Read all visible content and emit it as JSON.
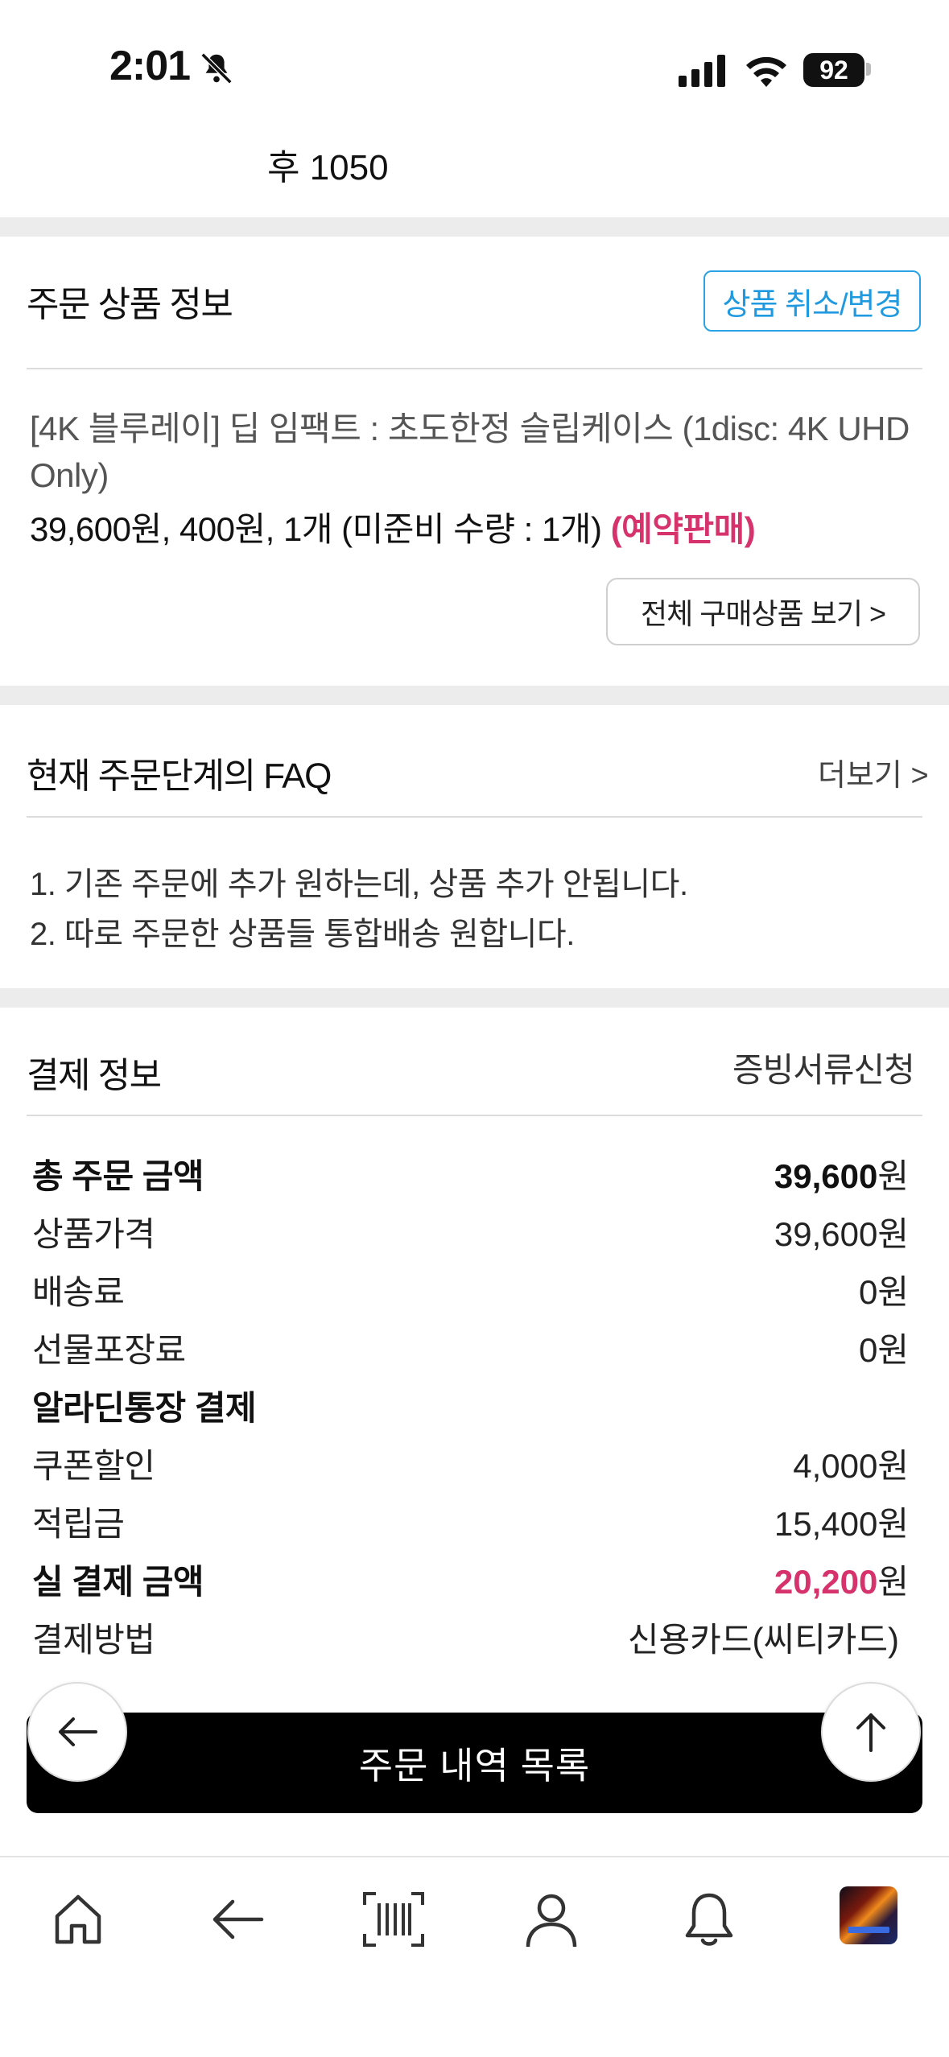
{
  "status": {
    "time": "2:01",
    "battery": "92"
  },
  "top_text": "후 1050",
  "order_product": {
    "title": "주문 상품 정보",
    "cancel_button": "상품 취소/변경",
    "product_name": "[4K 블루레이] 딥 임팩트 : 초도한정 슬립케이스 (1disc: 4K UHD Only)",
    "price_line": "39,600원, 400원, 1개 (미준비 수량 : 1개)",
    "presale_badge": "(예약판매)",
    "view_all_button": "전체 구매상품 보기 >"
  },
  "faq": {
    "title": "현재 주문단계의 FAQ",
    "more_label": "더보기 >",
    "items": [
      "1. 기존 주문에 추가 원하는데, 상품 추가 안됩니다.",
      "2. 따로 주문한 상품들 통합배송 원합니다."
    ]
  },
  "payment": {
    "title": "결제 정보",
    "cert_link": "증빙서류신청",
    "rows": [
      {
        "label": "총 주문 금액",
        "value": "39,600",
        "unit": "원"
      },
      {
        "label": "상품가격",
        "value": "39,600",
        "unit": "원"
      },
      {
        "label": "배송료",
        "value": "0",
        "unit": "원"
      },
      {
        "label": "선물포장료",
        "value": "0",
        "unit": "원"
      },
      {
        "label": "알라딘통장 결제",
        "value": "",
        "unit": ""
      },
      {
        "label": "쿠폰할인",
        "value": "4,000",
        "unit": "원"
      },
      {
        "label": "적립금",
        "value": "15,400",
        "unit": "원"
      },
      {
        "label": "실 결제 금액",
        "value": "20,200",
        "unit": "원"
      },
      {
        "label": "결제방법",
        "value": "신용카드(씨티카드)",
        "unit": ""
      }
    ]
  },
  "order_list_button": "주문 내역 목록",
  "accent_colors": {
    "pink": "#d6336c",
    "blue": "#1f9ae0"
  },
  "tabbar": [
    "home-icon",
    "back-arrow-icon",
    "barcode-scan-icon",
    "profile-icon",
    "bell-icon",
    "recent-product-thumbnail"
  ]
}
